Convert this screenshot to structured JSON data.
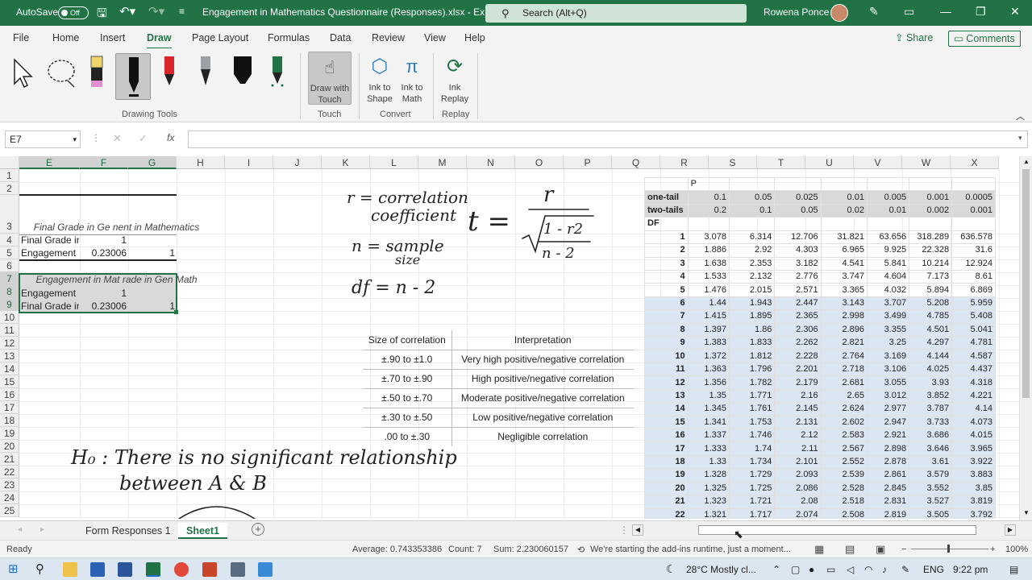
{
  "titlebar": {
    "autosave_label": "AutoSave",
    "autosave_state": "Off",
    "doc_title": "Engagement in Mathematics Questionnaire (Responses).xlsx  -  Ex...",
    "search_placeholder": "Search (Alt+Q)",
    "user_name": "Rowena Ponce"
  },
  "menu": {
    "items": [
      "File",
      "Home",
      "Insert",
      "Draw",
      "Page Layout",
      "Formulas",
      "Data",
      "Review",
      "View",
      "Help"
    ],
    "active": "Draw",
    "share_label": "Share",
    "comments_label": "Comments"
  },
  "ribbon": {
    "groups": {
      "drawing_tools": "Drawing Tools",
      "touch": "Touch",
      "convert": "Convert",
      "replay": "Replay"
    },
    "draw_with_touch": "Draw with Touch",
    "ink_to_shape": "Ink to Shape",
    "ink_to_math": "Ink to Math",
    "ink_replay": "Ink Replay"
  },
  "formula_bar": {
    "name_box": "E7",
    "fx": "fx",
    "formula": ""
  },
  "grid": {
    "columns": [
      "E",
      "F",
      "G",
      "H",
      "I",
      "J",
      "K",
      "L",
      "M",
      "N",
      "O",
      "P",
      "Q",
      "R",
      "S",
      "T",
      "U",
      "V",
      "W",
      "X"
    ],
    "rows": [
      "1",
      "2",
      "3",
      "4",
      "5",
      "6",
      "7",
      "8",
      "9",
      "10",
      "11",
      "12",
      "13",
      "14",
      "15",
      "16",
      "17",
      "18",
      "19",
      "20",
      "21",
      "22",
      "23",
      "24",
      "25"
    ],
    "block1_title": "Final Grade in General in Mathematics",
    "block1_title_shown": "Final Grade in Ge nent in Mathematics",
    "r4_label": "Final Grade ir",
    "r4_f": "1",
    "r5_label": "Engagement",
    "r5_f": "0.23006",
    "r5_g": "1",
    "block2_title": "Engagement in Mat rade in Gen Math",
    "r8_label": "Engagement",
    "r8_f": "1",
    "r9_label": "Final Grade ir",
    "r9_f": "0.23006",
    "r9_g": "1"
  },
  "correlation_table": {
    "headers": [
      "Size of correlation",
      "Interpretation"
    ],
    "rows": [
      [
        "±.90 to ±1.0",
        "Very high positive/negative correlation"
      ],
      [
        "±.70 to ±.90",
        "High positive/negative correlation"
      ],
      [
        "±.50 to ±.70",
        "Moderate positive/negative correlation"
      ],
      [
        "±.30 to ±.50",
        "Low positive/negative correlation"
      ],
      [
        ".00 to ±.30",
        "Negligible correlation"
      ]
    ]
  },
  "t_table": {
    "p_label": "P",
    "one_tail_label": "one-tail",
    "one_tail": [
      "0.1",
      "0.05",
      "0.025",
      "0.01",
      "0.005",
      "0.001",
      "0.0005"
    ],
    "two_tails_label": "two-tails",
    "two_tails": [
      "0.2",
      "0.1",
      "0.05",
      "0.02",
      "0.01",
      "0.002",
      "0.001"
    ],
    "df_label": "DF",
    "rows": [
      [
        "1",
        "3.078",
        "6.314",
        "12.706",
        "31.821",
        "63.656",
        "318.289",
        "636.578"
      ],
      [
        "2",
        "1.886",
        "2.92",
        "4.303",
        "6.965",
        "9.925",
        "22.328",
        "31.6"
      ],
      [
        "3",
        "1.638",
        "2.353",
        "3.182",
        "4.541",
        "5.841",
        "10.214",
        "12.924"
      ],
      [
        "4",
        "1.533",
        "2.132",
        "2.776",
        "3.747",
        "4.604",
        "7.173",
        "8.61"
      ],
      [
        "5",
        "1.476",
        "2.015",
        "2.571",
        "3.365",
        "4.032",
        "5.894",
        "6.869"
      ],
      [
        "6",
        "1.44",
        "1.943",
        "2.447",
        "3.143",
        "3.707",
        "5.208",
        "5.959"
      ],
      [
        "7",
        "1.415",
        "1.895",
        "2.365",
        "2.998",
        "3.499",
        "4.785",
        "5.408"
      ],
      [
        "8",
        "1.397",
        "1.86",
        "2.306",
        "2.896",
        "3.355",
        "4.501",
        "5.041"
      ],
      [
        "9",
        "1.383",
        "1.833",
        "2.262",
        "2.821",
        "3.25",
        "4.297",
        "4.781"
      ],
      [
        "10",
        "1.372",
        "1.812",
        "2.228",
        "2.764",
        "3.169",
        "4.144",
        "4.587"
      ],
      [
        "11",
        "1.363",
        "1.796",
        "2.201",
        "2.718",
        "3.106",
        "4.025",
        "4.437"
      ],
      [
        "12",
        "1.356",
        "1.782",
        "2.179",
        "2.681",
        "3.055",
        "3.93",
        "4.318"
      ],
      [
        "13",
        "1.35",
        "1.771",
        "2.16",
        "2.65",
        "3.012",
        "3.852",
        "4.221"
      ],
      [
        "14",
        "1.345",
        "1.761",
        "2.145",
        "2.624",
        "2.977",
        "3.787",
        "4.14"
      ],
      [
        "15",
        "1.341",
        "1.753",
        "2.131",
        "2.602",
        "2.947",
        "3.733",
        "4.073"
      ],
      [
        "16",
        "1.337",
        "1.746",
        "2.12",
        "2.583",
        "2.921",
        "3.686",
        "4.015"
      ],
      [
        "17",
        "1.333",
        "1.74",
        "2.11",
        "2.567",
        "2.898",
        "3.646",
        "3.965"
      ],
      [
        "18",
        "1.33",
        "1.734",
        "2.101",
        "2.552",
        "2.878",
        "3.61",
        "3.922"
      ],
      [
        "19",
        "1.328",
        "1.729",
        "2.093",
        "2.539",
        "2.861",
        "3.579",
        "3.883"
      ],
      [
        "20",
        "1.325",
        "1.725",
        "2.086",
        "2.528",
        "2.845",
        "3.552",
        "3.85"
      ],
      [
        "21",
        "1.323",
        "1.721",
        "2.08",
        "2.518",
        "2.831",
        "3.527",
        "3.819"
      ],
      [
        "22",
        "1.321",
        "1.717",
        "2.074",
        "2.508",
        "2.819",
        "3.505",
        "3.792"
      ]
    ]
  },
  "handwriting": {
    "r_def": "r = correlation coefficient",
    "n_def": "n = sample size",
    "df_def": "df = n - 2",
    "t_formula": "t = r / √(1-r²) / (n-2)",
    "hypothesis": "H₀: There is no significant relationship between A & B"
  },
  "sheet_tabs": {
    "tabs": [
      "Form Responses 1",
      "Sheet1"
    ],
    "active": "Sheet1",
    "add": "+"
  },
  "status": {
    "ready": "Ready",
    "average": "Average: 0.743353386",
    "count": "Count: 7",
    "sum": "Sum: 2.230060157",
    "message": "We're starting the add-ins runtime, just a moment...",
    "zoom": "100%"
  },
  "taskbar": {
    "weather": "28°C  Mostly cl...",
    "lang": "ENG",
    "time": "9:22 pm"
  },
  "colors": {
    "excel_green": "#217346",
    "table_grey": "#d9d9d9",
    "table_blue": "#dce6f2"
  }
}
